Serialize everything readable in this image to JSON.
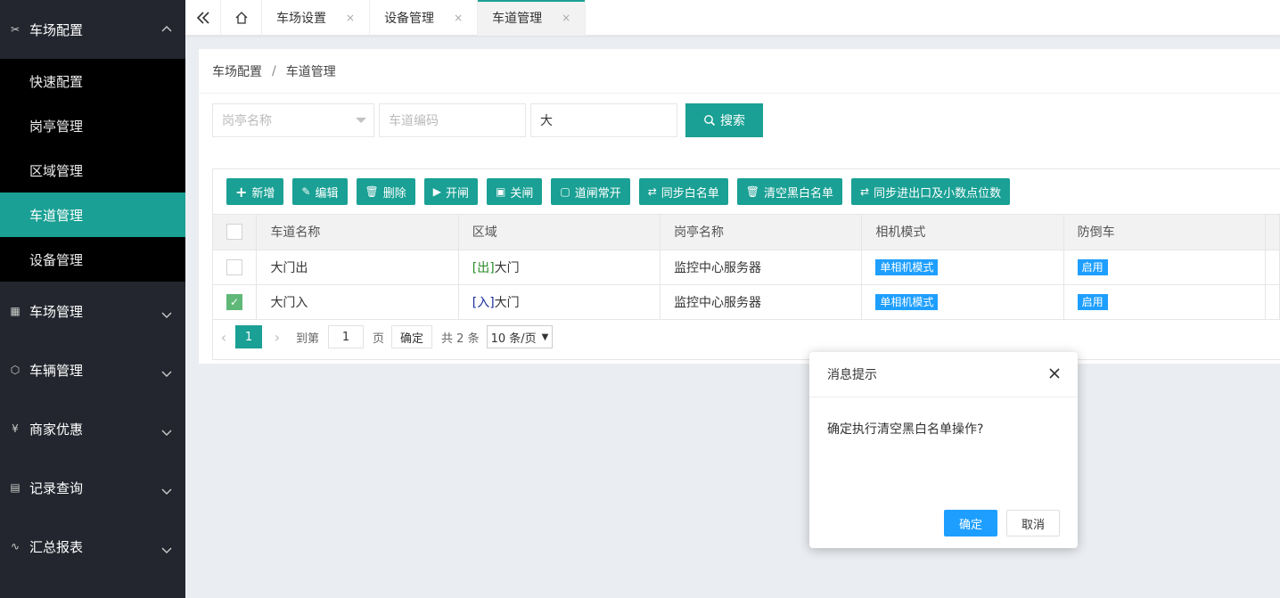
{
  "sidebar": {
    "top_group": {
      "label": "车场配置",
      "icon": "tools-icon"
    },
    "sub_items": [
      {
        "label": "快速配置"
      },
      {
        "label": "岗亭管理"
      },
      {
        "label": "区域管理"
      },
      {
        "label": "车道管理",
        "active": true
      },
      {
        "label": "设备管理"
      }
    ],
    "groups": [
      {
        "label": "车场管理",
        "icon": "grid-icon"
      },
      {
        "label": "车辆管理",
        "icon": "cube-icon"
      },
      {
        "label": "商家优惠",
        "icon": "yen-icon"
      },
      {
        "label": "记录查询",
        "icon": "document-icon"
      },
      {
        "label": "汇总报表",
        "icon": "pulse-icon"
      }
    ]
  },
  "tabs": {
    "items": [
      {
        "label": "车场设置",
        "close": "×"
      },
      {
        "label": "设备管理",
        "close": "×"
      },
      {
        "label": "车道管理",
        "close": "×",
        "active": true
      }
    ]
  },
  "breadcrumb": {
    "parent": "车场配置",
    "separator": "/",
    "current": "车道管理"
  },
  "search": {
    "booth_placeholder": "岗亭名称",
    "code_placeholder": "车道编码",
    "name_value": "大",
    "search_label": "搜索"
  },
  "toolbar": {
    "add": "新增",
    "edit": "编辑",
    "delete": "删除",
    "open": "开闸",
    "close": "关闸",
    "always_open": "道闸常开",
    "sync_whitelist": "同步白名单",
    "clear_blackwhite": "清空黑白名单",
    "sync_decimal": "同步进出口及小数点位数"
  },
  "table": {
    "headers": [
      "车道名称",
      "区域",
      "岗亭名称",
      "相机模式",
      "防倒车"
    ],
    "rows": [
      {
        "checked": false,
        "name": "大门出",
        "area_tag": "[出]",
        "area": "大门",
        "booth": "监控中心服务器",
        "camera": "单相机模式",
        "anti": "启用"
      },
      {
        "checked": true,
        "name": "大门入",
        "area_tag": "[入]",
        "area": "大门",
        "booth": "监控中心服务器",
        "camera": "单相机模式",
        "anti": "启用"
      }
    ]
  },
  "pager": {
    "current_page": "1",
    "goto_label": "到第",
    "goto_value": "1",
    "page_unit": "页",
    "confirm": "确定",
    "total": "共 2 条",
    "page_size": "10 条/页"
  },
  "dialog": {
    "title": "消息提示",
    "message": "确定执行清空黑白名单操作?",
    "ok": "确定",
    "cancel": "取消"
  },
  "colors": {
    "accent": "#1aa094",
    "blue": "#1e9fff",
    "sidebar_bg": "#23262e"
  }
}
